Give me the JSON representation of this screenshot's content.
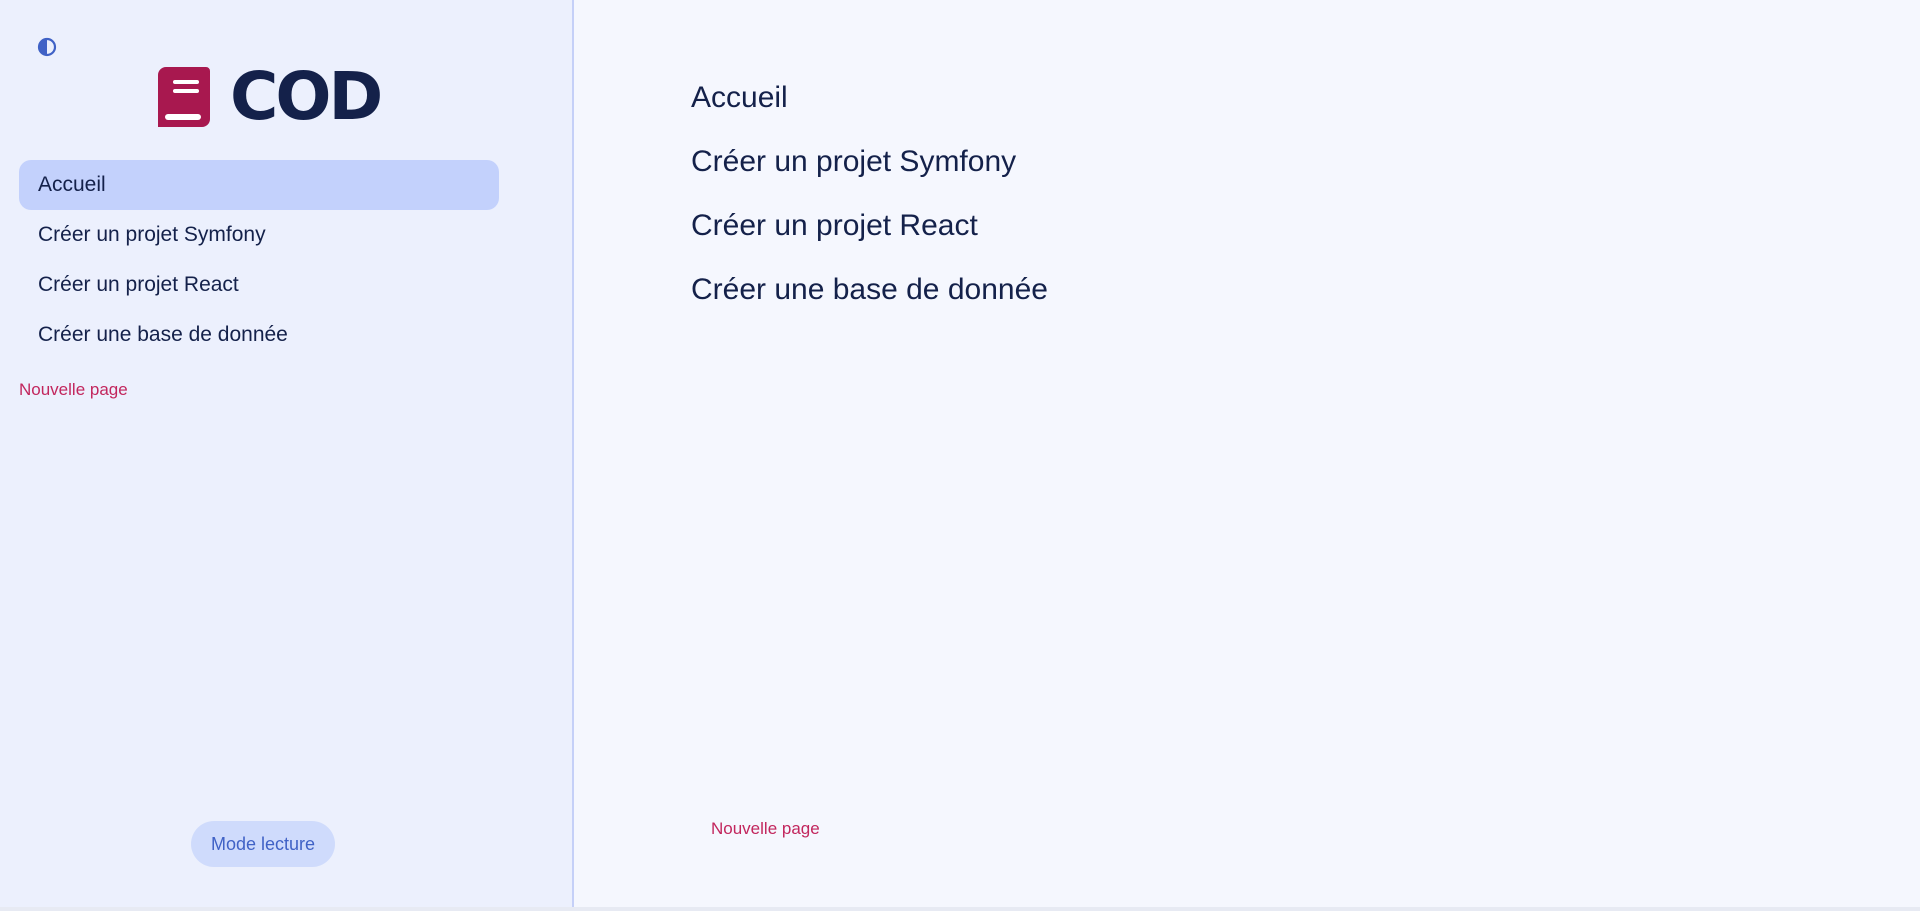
{
  "brand": {
    "title": "COD",
    "logo_icon": "book-icon",
    "logo_color": "#a8184f"
  },
  "theme_toggle": {
    "icon": "contrast-icon",
    "color": "#4062c6"
  },
  "sidebar": {
    "items": [
      {
        "label": "Accueil",
        "active": true
      },
      {
        "label": "Créer un projet Symfony",
        "active": false
      },
      {
        "label": "Créer un projet React",
        "active": false
      },
      {
        "label": "Créer une base de donnée",
        "active": false
      }
    ],
    "new_page_label": "Nouvelle page",
    "reading_mode_label": "Mode lecture"
  },
  "main": {
    "links": [
      {
        "label": "Accueil"
      },
      {
        "label": "Créer un projet Symfony"
      },
      {
        "label": "Créer un projet React"
      },
      {
        "label": "Créer une base de donnée"
      }
    ],
    "new_page_label": "Nouvelle page"
  },
  "colors": {
    "sidebar_bg": "#ecf0fd",
    "main_bg": "#f5f7fe",
    "active_item_bg": "#c3d1fc",
    "accent_pink": "#c2265d",
    "accent_blue": "#4062c6",
    "text_dark": "#14214a"
  }
}
